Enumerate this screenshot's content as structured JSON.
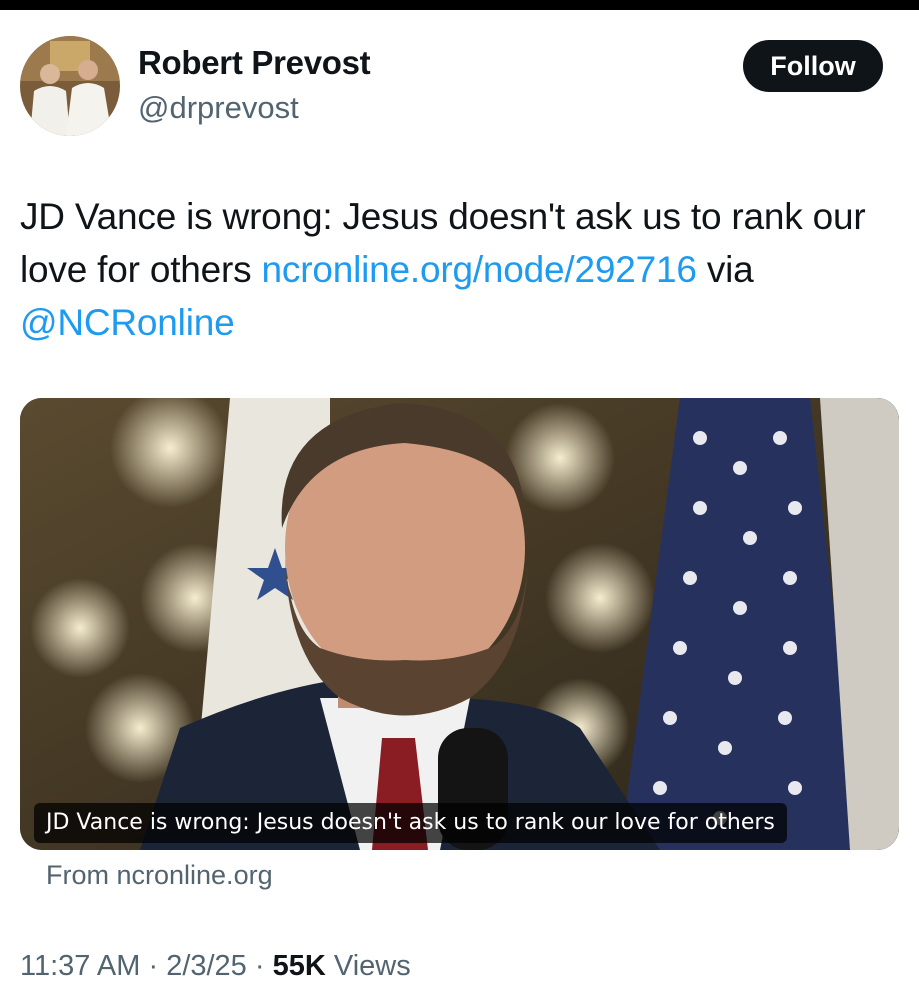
{
  "author": {
    "name": "Robert Prevost",
    "handle": "@drprevost",
    "follow_label": "Follow"
  },
  "tweet": {
    "text_before": "JD Vance is wrong: Jesus doesn't ask us to rank our love for others ",
    "link_text": "ncronline.org/node/292716",
    "text_middle": " via ",
    "mention": "@NCRonline"
  },
  "card": {
    "caption": "JD Vance is wrong: Jesus doesn't ask us to rank our love for others",
    "source": "From ncronline.org"
  },
  "meta": {
    "time": "11:37 AM",
    "separator": "·",
    "date": "2/3/25",
    "views_count": "55K",
    "views_label": "Views"
  },
  "colors": {
    "link": "#1d9bf0",
    "follow_bg": "#0f1419",
    "secondary_text": "#536471"
  }
}
